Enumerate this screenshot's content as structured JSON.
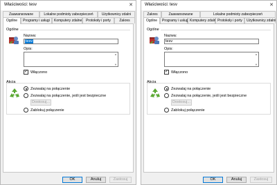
{
  "dialogs": [
    {
      "title": "Właściwości: tesv",
      "close_label": "✕",
      "tabs_row1": [
        "Zaawansowane",
        "Lokalne podmioty zabezpieczeń",
        "Użytkownicy zdalni"
      ],
      "tabs_row2": [
        "Ogólne",
        "Programy i usługi",
        "Komputery zdalne",
        "Protokoły i porty",
        "Zakres"
      ],
      "general": {
        "group_label": "Ogólne",
        "name_label": "Nazwa:",
        "name_value": "tesv",
        "desc_label": "Opis:",
        "enabled_label": "Włączono",
        "enabled_checked": true
      },
      "action": {
        "group_label": "Akcja",
        "options": [
          "Zezwalaj na połączenie",
          "Zezwalaj na połączenie, jeśli jest bezpieczne",
          "Zablokuj połączenie"
        ],
        "selected_index": 0,
        "customize_label": "Dostosuj..."
      },
      "buttons": {
        "ok": "OK",
        "cancel": "Anuluj",
        "apply": "Zastosuj"
      }
    },
    {
      "title": "Właściwości: tesv",
      "close_label": "✕",
      "tabs_row1": [
        "Zakres",
        "Zaawansowane",
        "Lokalne podmioty zabezpieczeń"
      ],
      "tabs_row2": [
        "Ogólne",
        "Programy i usługi",
        "Komputery zdalne",
        "Protokoły i porty",
        "Użytkownicy zdalni"
      ],
      "general": {
        "group_label": "Ogólne",
        "name_label": "Nazwa:",
        "name_value": "tesv",
        "desc_label": "Opis:",
        "enabled_label": "Włączono",
        "enabled_checked": true
      },
      "action": {
        "group_label": "Akcja",
        "options": [
          "Zezwalaj na połączenie",
          "Zezwalaj na połączenie, jeśli jest bezpieczne",
          "Zablokuj połączenie"
        ],
        "selected_index": 0,
        "customize_label": "Dostosuj..."
      },
      "buttons": {
        "ok": "OK",
        "cancel": "Anuluj",
        "apply": "Zastosuj"
      }
    }
  ],
  "icons": {
    "rule": "firewall-rule-user-icon",
    "action": "recycle-arrows-icon"
  },
  "colors": {
    "selection": "#0078d7",
    "arrow_green": "#5aa832"
  }
}
